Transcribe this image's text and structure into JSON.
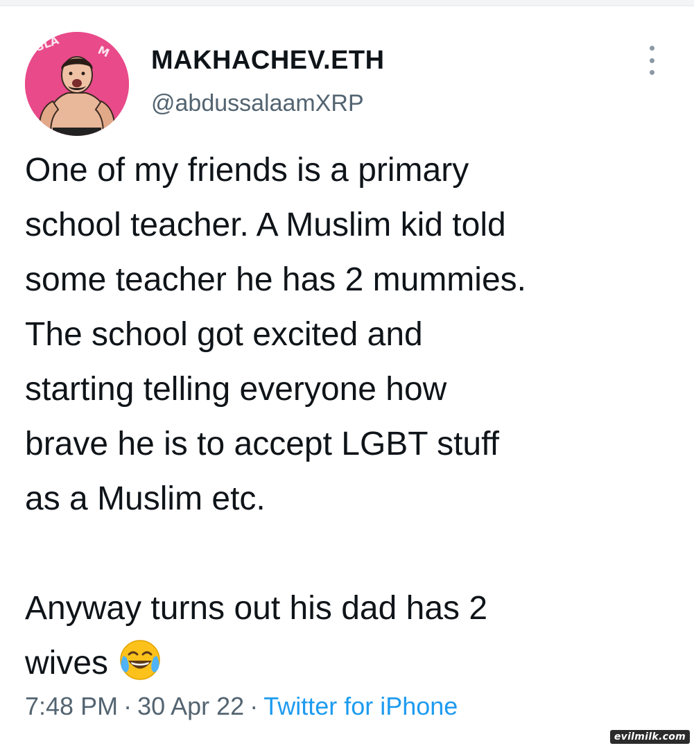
{
  "user": {
    "display_name": "MAKHACHEV.ETH",
    "handle": "@abdussalaamXRP",
    "avatar_icon": "profile-avatar-fighter",
    "avatar_bg_color": "#e84a8a"
  },
  "tweet": {
    "paragraphs": [
      "One of my friends is a primary\nschool teacher. A Muslim kid told\nsome teacher he has 2 mummies.\nThe school got excited and\nstarting telling everyone how\nbrave he is to accept LGBT stuff\nas a Muslim etc.",
      "Anyway turns out his dad has 2\nwives"
    ],
    "emoji": "face-with-tears-of-joy-icon"
  },
  "meta": {
    "time": "7:48 PM",
    "separator": "·",
    "date": "30 Apr 22",
    "source": "Twitter for iPhone"
  },
  "more_icon": "more-vertical-icon",
  "watermark": "evilmilk.com",
  "colors": {
    "text": "#0f1419",
    "secondary": "#536471",
    "link": "#1d9bf0"
  }
}
